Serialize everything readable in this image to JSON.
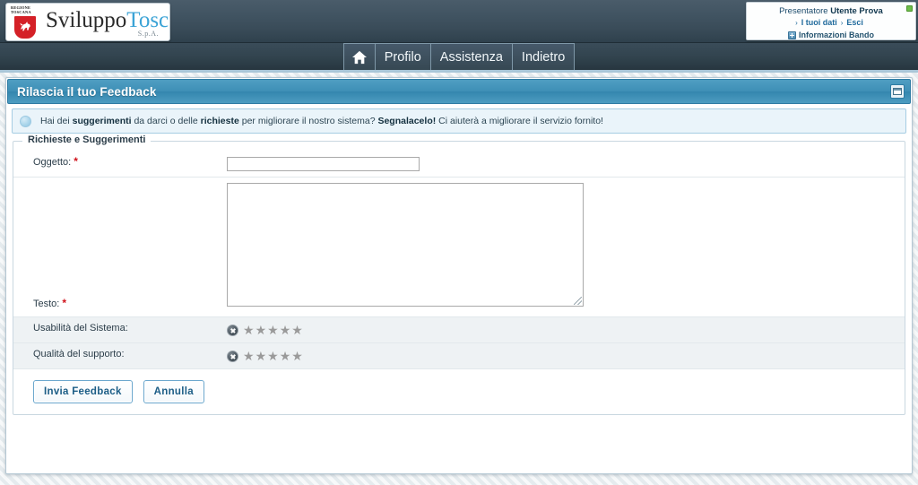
{
  "header": {
    "logo": {
      "crest_line1": "REGIONE",
      "crest_line2": "TOSCANA",
      "brand_part1": "Sviluppo",
      "brand_part2": "Toscana",
      "brand_suffix": "S.p.A.",
      "crest_color": "#d42027",
      "brand_accent": "#3ba3d6"
    },
    "user_panel": {
      "role_prefix": "Presentatore ",
      "user_name": "Utente Prova",
      "link_data": "I tuoi dati",
      "link_logout": "Esci",
      "info_link": "Informazioni Bando",
      "arrow_glyph": "›"
    }
  },
  "nav": {
    "items": [
      {
        "label": "",
        "icon": "home-icon",
        "name": "nav-home"
      },
      {
        "label": "Profilo",
        "icon": "",
        "name": "nav-profilo"
      },
      {
        "label": "Assistenza",
        "icon": "",
        "name": "nav-assistenza"
      },
      {
        "label": "Indietro",
        "icon": "",
        "name": "nav-indietro"
      }
    ]
  },
  "panel": {
    "title": "Rilascia il tuo Feedback",
    "title_bar_color": "#3e8fb6",
    "tool_icon": "restore-window-icon"
  },
  "notice": {
    "icon": "info-bubble-icon",
    "text_1": "Hai dei ",
    "bold_1": "suggerimenti",
    "text_2": " da darci o delle ",
    "bold_2": "richieste",
    "text_3": " per migliorare il nostro sistema? ",
    "bold_3": "Segnalacelo!",
    "text_4": " Ci aiuterà a migliorare il servizio fornito!"
  },
  "form": {
    "legend": "Richieste e Suggerimenti",
    "required_marker": "*",
    "fields": {
      "oggetto": {
        "label": "Oggetto:",
        "value": "",
        "placeholder": "",
        "required": true
      },
      "testo": {
        "label": "Testo:",
        "value": "",
        "placeholder": "",
        "required": true
      },
      "usabilita": {
        "label": "Usabilità del Sistema:",
        "value": 0,
        "max": 5,
        "clear_icon": "clear-rating-icon"
      },
      "qualita": {
        "label": "Qualità del supporto:",
        "value": 0,
        "max": 5,
        "clear_icon": "clear-rating-icon"
      }
    },
    "star_glyph": "★",
    "buttons": {
      "submit": "Invia Feedback",
      "cancel": "Annulla"
    }
  }
}
